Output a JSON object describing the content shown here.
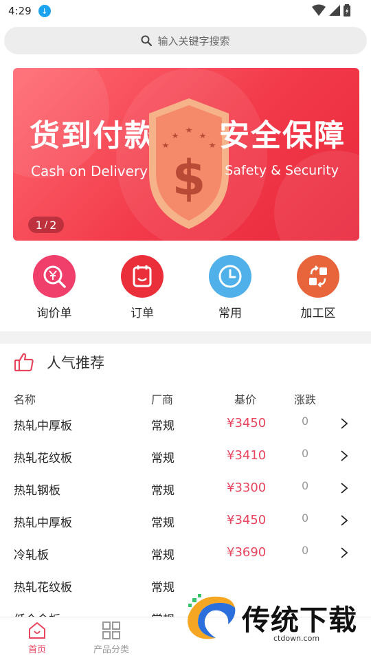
{
  "status_bar": {
    "time": "4:29"
  },
  "search": {
    "placeholder": "输入关键字搜索"
  },
  "banner": {
    "title_left": "货到付款",
    "subtitle_left": "Cash on Delivery",
    "title_right": "安全保障",
    "subtitle_right": "Safety & Security",
    "indicator_current": "1",
    "indicator_sep": "/",
    "indicator_total": "2",
    "colors": {
      "main": "#f23a4a",
      "shield": "#f6b38a"
    }
  },
  "quick_menu": [
    {
      "label": "询价单",
      "icon": "inquiry-icon",
      "color": "#ef3f6a"
    },
    {
      "label": "订单",
      "icon": "order-icon",
      "color": "#ea2f3b"
    },
    {
      "label": "常用",
      "icon": "clock-icon",
      "color": "#4fb0ea"
    },
    {
      "label": "加工区",
      "icon": "exchange-icon",
      "color": "#e8643a"
    }
  ],
  "popular": {
    "title": "人气推荐",
    "headers": {
      "name": "名称",
      "maker": "厂商",
      "price": "基价",
      "change": "涨跌"
    },
    "rows": [
      {
        "name": "热轧中厚板",
        "maker": "常规",
        "price": "¥3450",
        "change": "0"
      },
      {
        "name": "热轧花纹板",
        "maker": "常规",
        "price": "¥3410",
        "change": "0"
      },
      {
        "name": "热轧钢板",
        "maker": "常规",
        "price": "¥3300",
        "change": "0"
      },
      {
        "name": "热轧中厚板",
        "maker": "常规",
        "price": "¥3450",
        "change": "0"
      },
      {
        "name": "冷轧板",
        "maker": "常规",
        "price": "¥3690",
        "change": "0"
      },
      {
        "name": "热轧花纹板",
        "maker": "常规",
        "price": "",
        "change": ""
      },
      {
        "name": "低合金板",
        "maker": "常规",
        "price": "",
        "change": ""
      }
    ]
  },
  "bottom_nav": [
    {
      "label": "首页",
      "icon": "home-icon",
      "active": true
    },
    {
      "label": "产品分类",
      "icon": "grid-icon",
      "active": false
    }
  ],
  "watermark": {
    "text": "传统下载",
    "url": "ctdown.com"
  },
  "accent_color": "#e8455f"
}
